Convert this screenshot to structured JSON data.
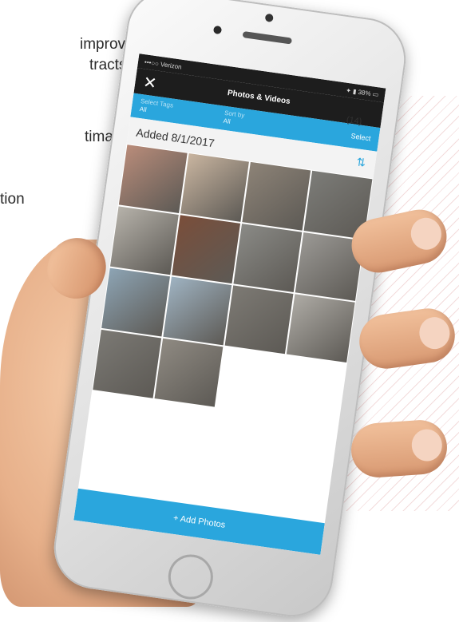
{
  "background_text": {
    "line1": "improve",
    "line2": "tracts",
    "line3": "timate",
    "line4": "tion"
  },
  "status_bar": {
    "carrier": "•••○○ Verizon",
    "battery": "✦ ▮ 38% ▭"
  },
  "nav": {
    "close_icon": "close-icon",
    "title": "Photos & Videos"
  },
  "filters": {
    "tags_label": "Select Tags",
    "tags_value": "All",
    "sort_label": "Sort by",
    "sort_value": "All",
    "select_label": "Select"
  },
  "group": {
    "date": "Added 8/1/2017",
    "count": "(14)",
    "sort_icon": "sort-icon"
  },
  "photos": [
    "#b98c7a",
    "#c9b5a0",
    "#8d8377",
    "#7c7c78",
    "#b6b2aa",
    "#7a4e3a",
    "#8a8a86",
    "#9b9995",
    "#8da4b4",
    "#9fb3c2",
    "#7d7a74",
    "#aeaba5",
    "#7b7974",
    "#8f8a82"
  ],
  "add_button": {
    "label": "+ Add Photos"
  },
  "colors": {
    "accent": "#2aa6dd",
    "dark_bar": "#1d1d1d"
  }
}
